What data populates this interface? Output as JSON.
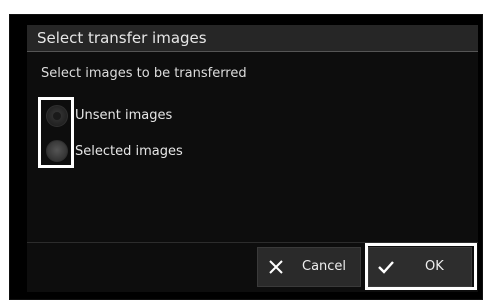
{
  "dialog": {
    "title": "Select transfer images",
    "prompt": "Select images to be transferred",
    "options": [
      {
        "label": "Unsent images",
        "selected": true
      },
      {
        "label": "Selected images",
        "selected": false
      }
    ],
    "buttons": {
      "cancel_label": "Cancel",
      "ok_label": "OK"
    }
  },
  "colors": {
    "dialog_background": "#0d0d0d",
    "titlebar": "#262626",
    "button": "#2a2a2a",
    "highlight_outline": "#ffffff",
    "text": "#e6e6e6"
  },
  "icons": {
    "cancel": "close-icon",
    "ok": "checkmark-icon"
  }
}
